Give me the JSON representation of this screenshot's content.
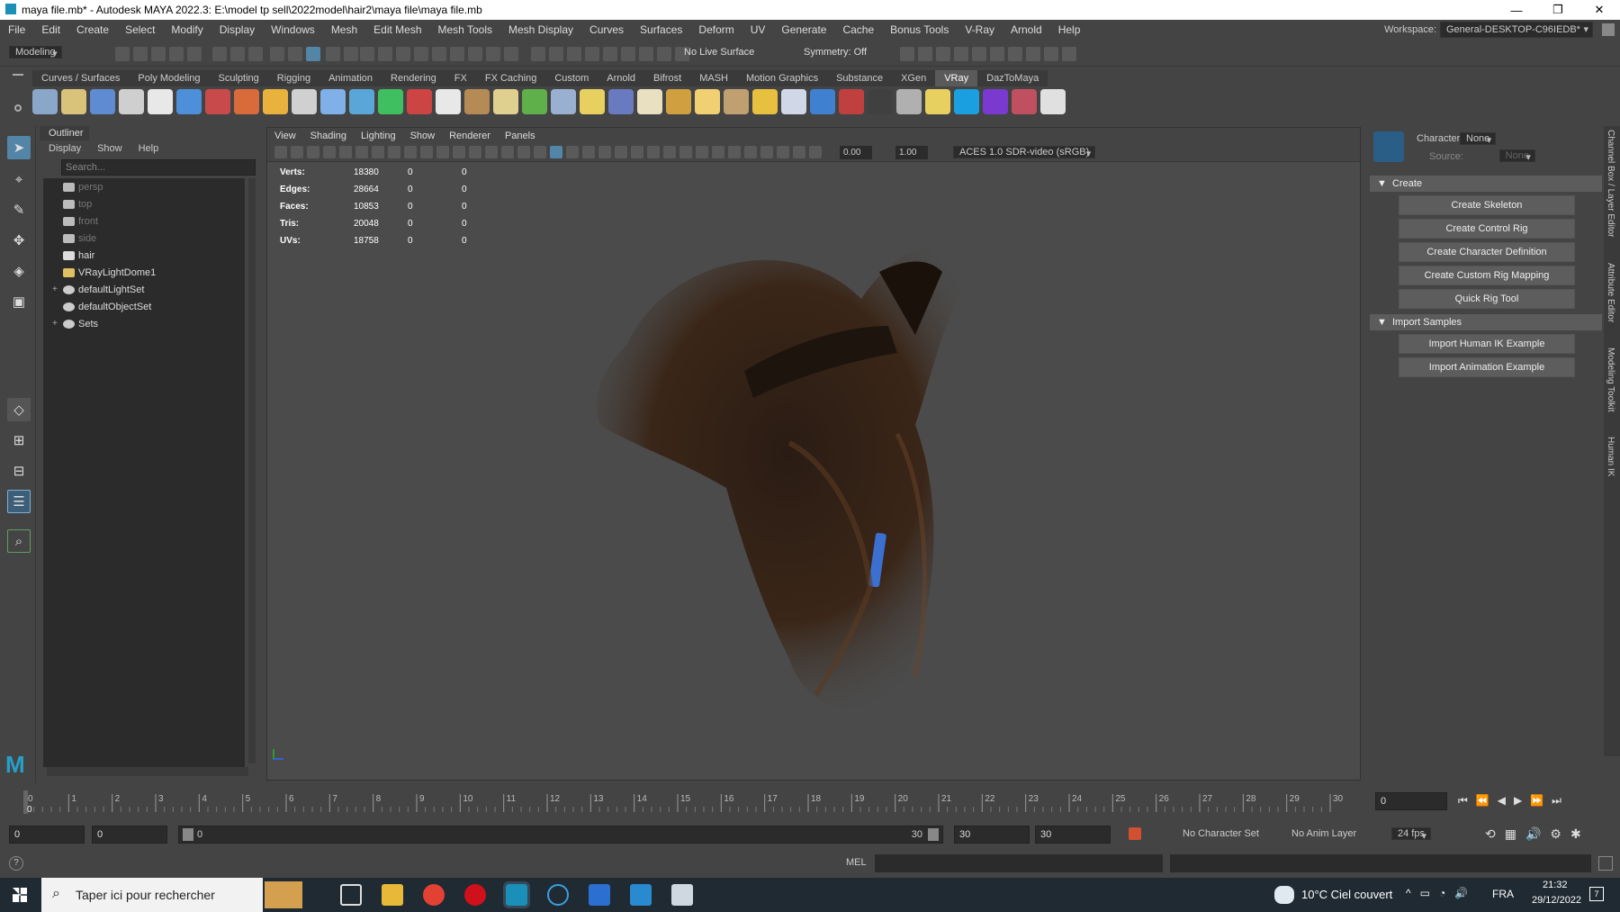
{
  "window": {
    "title": "maya file.mb* - Autodesk MAYA 2022.3: E:\\model tp sell\\2022model\\hair2\\maya file\\maya file.mb",
    "minimize": "—",
    "maximize": "❐",
    "close": "✕"
  },
  "menubar": [
    "File",
    "Edit",
    "Create",
    "Select",
    "Modify",
    "Display",
    "Windows",
    "Mesh",
    "Edit Mesh",
    "Mesh Tools",
    "Mesh Display",
    "Curves",
    "Surfaces",
    "Deform",
    "UV",
    "Generate",
    "Cache",
    "Bonus Tools",
    "V-Ray",
    "Arnold",
    "Help"
  ],
  "workspace": {
    "label": "Workspace:",
    "value": "General-DESKTOP-C96IEDB*"
  },
  "statusline": {
    "mode": "Modeling",
    "live_surface": "No Live Surface",
    "symmetry": "Symmetry: Off"
  },
  "shelf_tabs": [
    "Curves / Surfaces",
    "Poly Modeling",
    "Sculpting",
    "Rigging",
    "Animation",
    "Rendering",
    "FX",
    "FX Caching",
    "Custom",
    "Arnold",
    "Bifrost",
    "MASH",
    "Motion Graphics",
    "Substance",
    "XGen",
    "VRay",
    "DazToMaya"
  ],
  "shelf_active": "VRay",
  "shelf_icon_colors": [
    "#8aa7c9",
    "#d9c27a",
    "#5e8bd1",
    "#cfcfcf",
    "#e8e8e8",
    "#4d8fd9",
    "#c94a4a",
    "#d96b3b",
    "#e8b23d",
    "#d0d0d0",
    "#7fb0e8",
    "#5aa6d9",
    "#3fbf5f",
    "#cc4444",
    "#e8e8e8",
    "#b58a54",
    "#e0d090",
    "#5fb04a",
    "#9ab0d0",
    "#e8d060",
    "#6a7ac0",
    "#e8e0c0",
    "#d0a040",
    "#f0d070",
    "#c0a070",
    "#e8c040",
    "#d0d8e8",
    "#4080d0",
    "#c04040",
    "#404040",
    "#b0b0b0",
    "#e8d060",
    "#1aa0e0",
    "#7a3ad0",
    "#c05060",
    "#e0e0e0"
  ],
  "outliner": {
    "title": "Outliner",
    "menu": [
      "Display",
      "Show",
      "Help"
    ],
    "search_placeholder": "Search...",
    "items": [
      {
        "label": "persp",
        "dim": true,
        "icon": "camera-icon"
      },
      {
        "label": "top",
        "dim": true,
        "icon": "camera-icon"
      },
      {
        "label": "front",
        "dim": true,
        "icon": "camera-icon"
      },
      {
        "label": "side",
        "dim": true,
        "icon": "camera-icon"
      },
      {
        "label": "hair",
        "dim": false,
        "icon": "mesh-icon"
      },
      {
        "label": "VRayLightDome1",
        "dim": false,
        "icon": "dome-light-icon"
      },
      {
        "label": "defaultLightSet",
        "dim": false,
        "icon": "set-icon",
        "expander": "+"
      },
      {
        "label": "defaultObjectSet",
        "dim": false,
        "icon": "set-icon"
      },
      {
        "label": "Sets",
        "dim": false,
        "icon": "set-icon",
        "expander": "+"
      }
    ]
  },
  "viewport": {
    "menu": [
      "View",
      "Shading",
      "Lighting",
      "Show",
      "Renderer",
      "Panels"
    ],
    "exposure": "0.00",
    "gamma": "1.00",
    "color_space": "ACES 1.0 SDR-video (sRGB)",
    "hud": [
      {
        "label": "Verts:",
        "a": "18380",
        "b": "0",
        "c": "0"
      },
      {
        "label": "Edges:",
        "a": "28664",
        "b": "0",
        "c": "0"
      },
      {
        "label": "Faces:",
        "a": "10853",
        "b": "0",
        "c": "0"
      },
      {
        "label": "Tris:",
        "a": "20048",
        "b": "0",
        "c": "0"
      },
      {
        "label": "UVs:",
        "a": "18758",
        "b": "0",
        "c": "0"
      }
    ]
  },
  "humanik": {
    "character_label": "Character:",
    "character_value": "None",
    "source_label": "Source:",
    "source_value": "None",
    "create_section": "Create",
    "create_buttons": [
      "Create Skeleton",
      "Create Control Rig",
      "Create Character Definition",
      "Create Custom Rig Mapping",
      "Quick Rig Tool"
    ],
    "import_section": "Import Samples",
    "import_buttons": [
      "Import Human IK Example",
      "Import Animation Example"
    ]
  },
  "side_tabs": [
    "Channel Box / Layer Editor",
    "Attribute Editor",
    "Modeling Toolkit",
    "Human IK"
  ],
  "timeline": {
    "ticks": [
      "0",
      "1",
      "2",
      "3",
      "4",
      "5",
      "6",
      "7",
      "8",
      "9",
      "10",
      "11",
      "12",
      "13",
      "14",
      "15",
      "16",
      "17",
      "18",
      "19",
      "20",
      "21",
      "22",
      "23",
      "24",
      "25",
      "26",
      "27",
      "28",
      "29",
      "30"
    ],
    "current_frame": "0"
  },
  "range": {
    "start": "0",
    "anim_start": "0",
    "slider_start": "0",
    "slider_end": "30",
    "end": "30",
    "anim_end": "30",
    "character_set": "No Character Set",
    "anim_layer": "No Anim Layer",
    "fps": "24 fps"
  },
  "cmdline": {
    "lang": "MEL",
    "help": "?"
  },
  "taskbar": {
    "search": "Taper ici pour rechercher",
    "weather": "10°C  Ciel couvert",
    "lang": "FRA",
    "time": "21:32",
    "date": "29/12/2022",
    "notif": "7"
  }
}
